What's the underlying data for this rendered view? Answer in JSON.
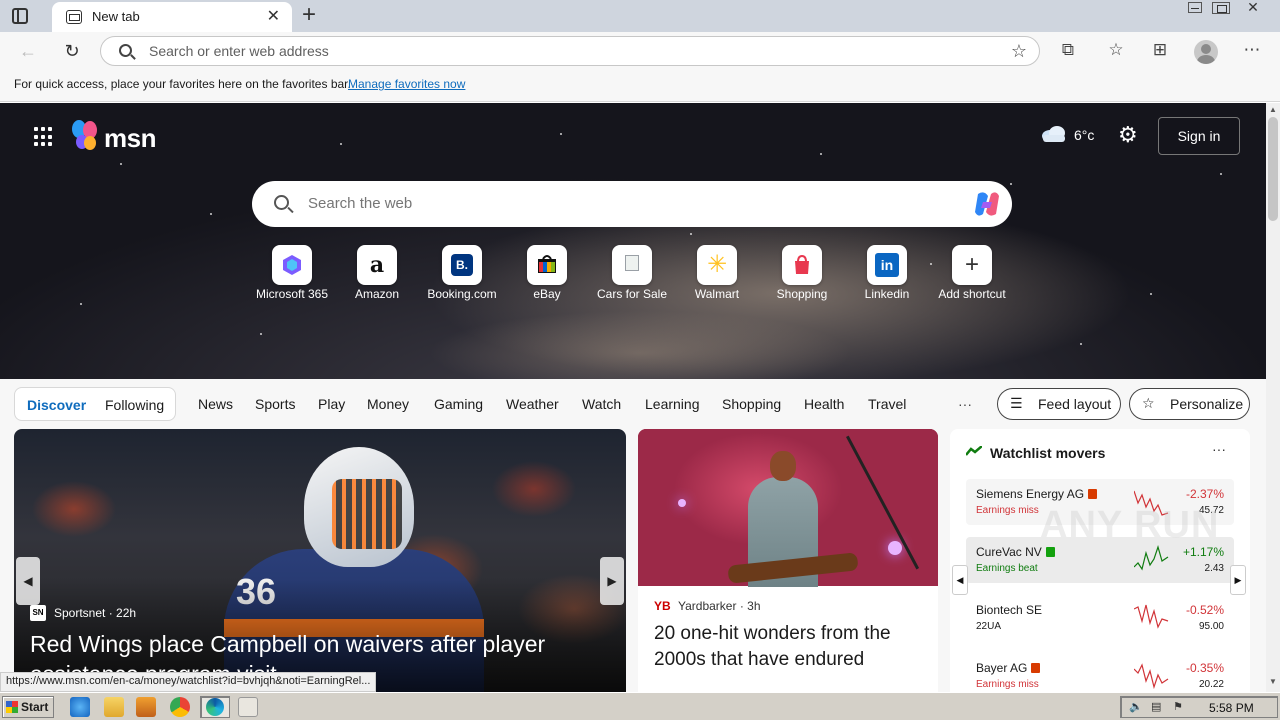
{
  "browser": {
    "tab_title": "New tab",
    "new_tab_symbol": "+",
    "close_symbol": "✕",
    "address_placeholder": "Search or enter web address",
    "favbar_message": "For quick access, place your favorites here on the favorites bar.",
    "favbar_link": "Manage favorites now",
    "status_url": "https://www.msn.com/en-ca/money/watchlist?id=bvhjqh&noti=EarningRel..."
  },
  "msn": {
    "logo_text": "msn",
    "weather_temp": "6°c",
    "signin_label": "Sign in",
    "search_placeholder": "Search the web"
  },
  "shortcuts": [
    {
      "label": "Microsoft 365",
      "icon": "microsoft-365-icon",
      "glyph": "",
      "color": "#7b5cff"
    },
    {
      "label": "Amazon",
      "icon": "amazon-icon",
      "glyph": "a",
      "color": "#111111"
    },
    {
      "label": "Booking.com",
      "icon": "booking-icon",
      "glyph": "B.",
      "color": "#003580"
    },
    {
      "label": "eBay",
      "icon": "ebay-icon",
      "glyph": "",
      "color": "#e53238"
    },
    {
      "label": "Cars for Sale",
      "icon": "cars-for-sale-icon",
      "glyph": "",
      "color": "#9aa0a6"
    },
    {
      "label": "Walmart",
      "icon": "walmart-icon",
      "glyph": "✳",
      "color": "#ffc220"
    },
    {
      "label": "Shopping",
      "icon": "shopping-bag-icon",
      "glyph": "",
      "color": "#e8384f"
    },
    {
      "label": "Linkedin",
      "icon": "linkedin-icon",
      "glyph": "in",
      "color": "#0a66c2"
    },
    {
      "label": "Add shortcut",
      "icon": "plus-icon",
      "glyph": "+",
      "color": "#333333"
    }
  ],
  "nav": {
    "discover": "Discover",
    "following": "Following",
    "items": [
      "News",
      "Sports",
      "Play",
      "Money",
      "Gaming",
      "Weather",
      "Watch",
      "Learning",
      "Shopping",
      "Health",
      "Travel"
    ],
    "more": "···",
    "feed_layout": "Feed layout",
    "personalize": "Personalize"
  },
  "main_story": {
    "source": "Sportsnet",
    "age": "22h",
    "headline": "Red Wings place Campbell on waivers after player assistance program visit",
    "jersey_number": "36"
  },
  "side_story": {
    "source": "Yardbarker",
    "age": "3h",
    "headline": "20 one-hit wonders from the 2000s that have endured"
  },
  "watchlist": {
    "title": "Watchlist movers",
    "more": "···",
    "stocks": [
      {
        "name": "Siemens Energy AG",
        "sub": "Earnings miss",
        "change": "-2.37%",
        "price": "45.72",
        "dir": "down"
      },
      {
        "name": "CureVac NV",
        "sub": "Earnings beat",
        "change": "+1.17%",
        "price": "2.43",
        "dir": "up"
      },
      {
        "name": "Biontech SE",
        "sub": "22UA",
        "change": "-0.52%",
        "price": "95.00",
        "dir": "down"
      },
      {
        "name": "Bayer AG",
        "sub": "Earnings miss",
        "change": "-0.35%",
        "price": "20.22",
        "dir": "down"
      }
    ]
  },
  "colors": {
    "accent": "#0f6cbd",
    "negative": "#d13438",
    "positive": "#107c10"
  },
  "watermark": "ANY RUN",
  "taskbar": {
    "start_label": "Start",
    "clock": "5:58 PM"
  }
}
